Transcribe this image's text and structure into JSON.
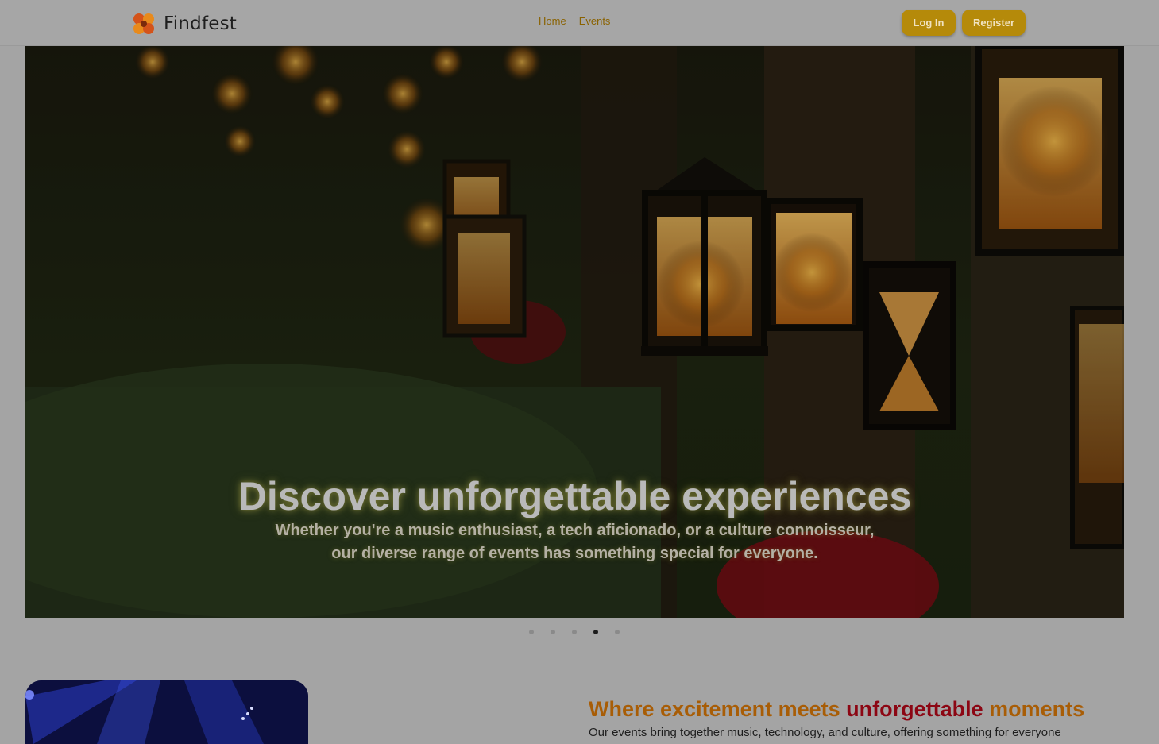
{
  "header": {
    "brand_name": "Findfest",
    "logo_icon": "flower-logo-icon",
    "nav": [
      {
        "label": "Home"
      },
      {
        "label": "Events"
      }
    ],
    "login_label": "Log In",
    "register_label": "Register"
  },
  "hero": {
    "title": "Discover unforgettable experiences",
    "subtitle_line1": "Whether you're a music enthusiast, a tech aficionado, or a culture connoisseur,",
    "subtitle_line2": "our diverse range of events has something special for everyone."
  },
  "carousel": {
    "slide_count": 5,
    "active_index": 3
  },
  "intro": {
    "heading_part1": "Where excitement meets ",
    "heading_emphasis": "unforgettable",
    "heading_part2": " moments",
    "body": "Our events bring together music, technology, and culture, offering something for everyone"
  },
  "colors": {
    "accent": "#b58a0a",
    "heading_orange": "#a85d06",
    "heading_red": "#8c0613"
  }
}
